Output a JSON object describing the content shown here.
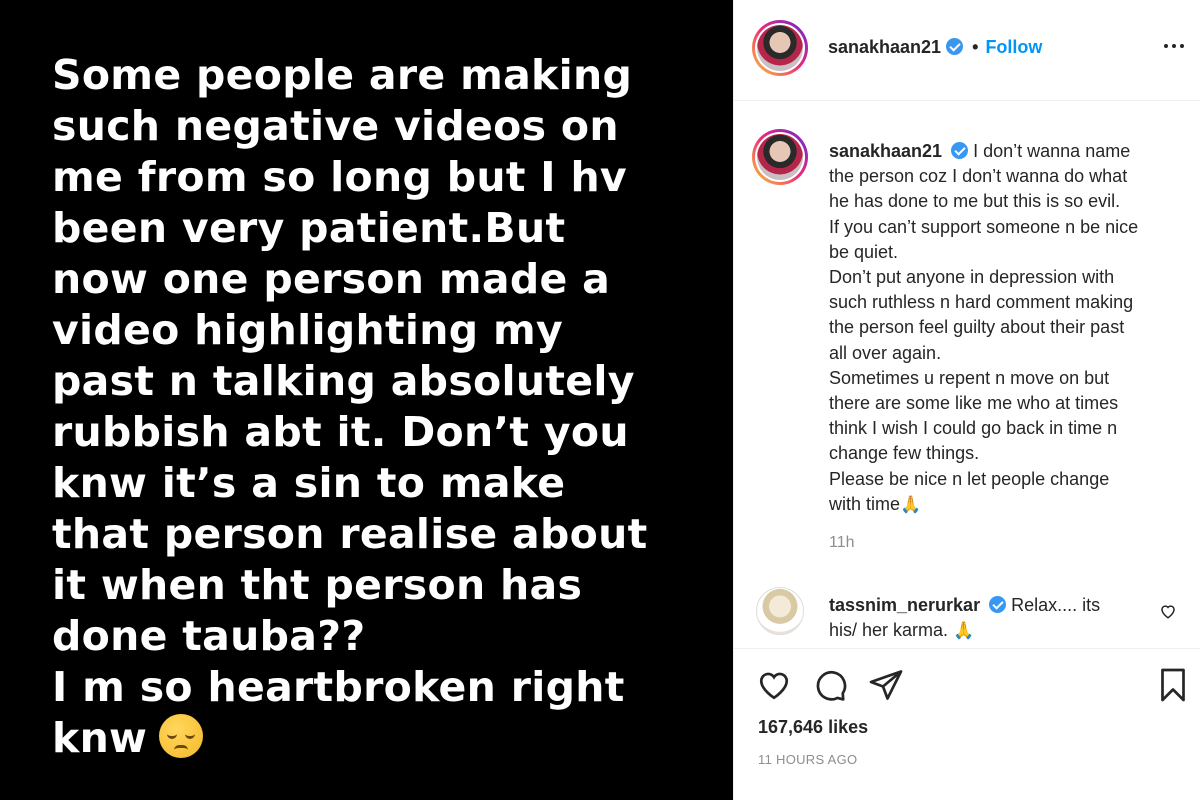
{
  "story": {
    "lines": [
      "Some people are making",
      "such negative videos on",
      "me from so long but I hv",
      "been very patient.But",
      "now one person made a",
      "video highlighting my",
      "past n talking absolutely",
      "rubbish abt it. Don’t you",
      "knw it’s a sin to make",
      "that person realise about",
      "it when tht person has",
      "done tauba??",
      "I m so heartbroken right",
      "knw"
    ],
    "emoji": "pensive-face"
  },
  "header": {
    "username": "sanakhaan21",
    "separator": "•",
    "follow_label": "Follow"
  },
  "caption": {
    "username": "sanakhaan21",
    "lines": [
      "I don’t wanna name",
      "the person coz I don’t wanna do what",
      "he has done to me but this is so evil.",
      "If you can’t support someone n be nice",
      "be quiet.",
      "Don’t put anyone in depression with",
      "such ruthless n hard comment making",
      "the person feel guilty about their past",
      "all over again.",
      "Sometimes u repent n move on but",
      "there are some like me who at times",
      "think I wish I could go back in time n",
      "change few things.",
      "Please be nice n let people change",
      "with time"
    ],
    "emoji": "🙏",
    "time": "11h"
  },
  "comment": {
    "username": "tassnim_nerurkar",
    "text_line1": "Relax.... its",
    "text_line2": "his/ her karma.",
    "emoji": "🙏"
  },
  "actions": {
    "likes": "167,646 likes",
    "timestamp": "11 HOURS AGO"
  },
  "colors": {
    "follow_blue": "#0095f6",
    "verified_blue": "#3897f0",
    "muted_gray": "#8e8e8e"
  }
}
